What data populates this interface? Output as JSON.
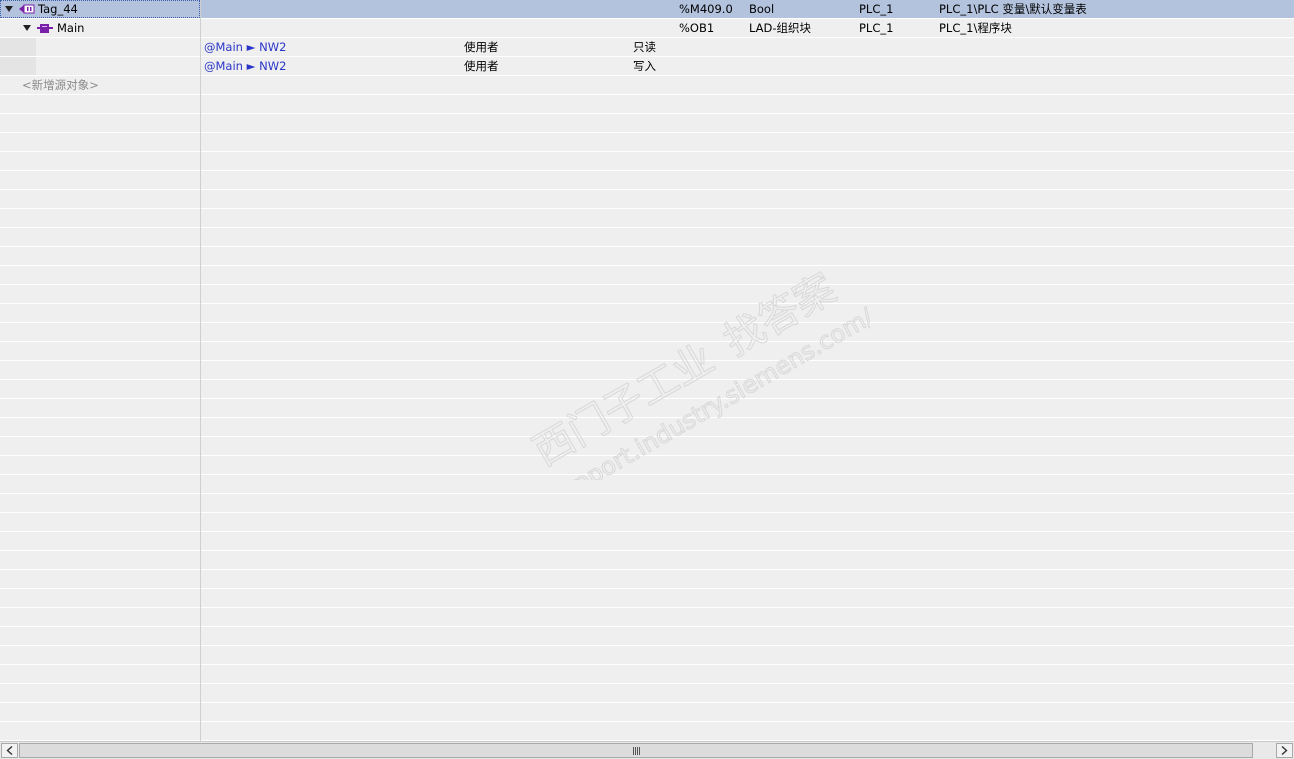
{
  "rows": [
    {
      "name": "Tag_44",
      "address": "%M409.0",
      "type": "Bool",
      "device": "PLC_1",
      "path": "PLC_1\\PLC 变量\\默认变量表"
    },
    {
      "name": "Main",
      "address": "%OB1",
      "type": "LAD-组织块",
      "device": "PLC_1",
      "path": "PLC_1\\程序块"
    },
    {
      "ref": "@Main ► NW2",
      "usage": "使用者",
      "access": "只读"
    },
    {
      "ref": "@Main ► NW2",
      "usage": "使用者",
      "access": "写入"
    }
  ],
  "add_new": "<新增源对象>",
  "watermark": {
    "line1": "西门子工业",
    "line2": "找答案",
    "line3": "support.industry.siemens.com/cs"
  },
  "colors": {
    "selected_row": "#b3c3dd",
    "link": "#2a36c8",
    "icon_purple": "#7a1fa8"
  },
  "icons": {
    "tag": "tag-variable-icon",
    "block": "organization-block-icon",
    "expand": "expand-triangle-icon",
    "scroll_left": "arrow-left-icon",
    "scroll_right": "arrow-right-icon"
  }
}
